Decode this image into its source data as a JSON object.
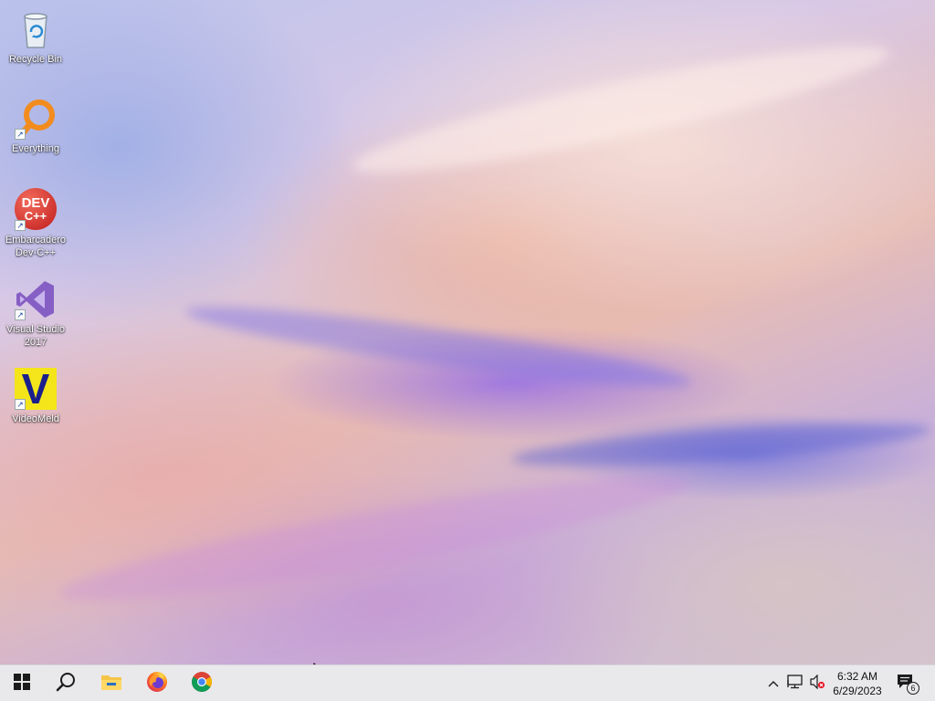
{
  "desktop": {
    "icons": [
      {
        "label": "Recycle Bin",
        "icon": "recycle-bin-icon",
        "shortcut": false
      },
      {
        "label": "Everything",
        "icon": "everything-search-icon",
        "shortcut": true
      },
      {
        "label": "Embarcadero\nDev-C++",
        "icon": "devcpp-icon",
        "icon_text_top": "DEV",
        "icon_text_bottom": "C++",
        "shortcut": true
      },
      {
        "label": "Visual Studio\n2017",
        "icon": "visual-studio-icon",
        "shortcut": true
      },
      {
        "label": "VideoMeld",
        "icon": "videomeld-icon",
        "icon_text": "V",
        "shortcut": true
      }
    ]
  },
  "taskbar": {
    "apps": [
      {
        "name": "Start",
        "icon": "windows-start-icon"
      },
      {
        "name": "Search",
        "icon": "search-icon"
      },
      {
        "name": "File Explorer",
        "icon": "folder-icon"
      },
      {
        "name": "Firefox",
        "icon": "firefox-icon"
      },
      {
        "name": "Chrome",
        "icon": "chrome-icon"
      }
    ],
    "tray": {
      "icons": [
        "chevron-up-icon",
        "network-icon",
        "volume-muted-icon"
      ],
      "time": "6:32 AM",
      "date": "6/29/2023",
      "notification_icon": "action-center-icon",
      "notification_count": "6"
    }
  },
  "colors": {
    "taskbar_bg": "#e9e9ec",
    "windows_blue": "#0078d7",
    "devcpp_red": "#d9302b",
    "vs_purple": "#865fc5",
    "everything_orange": "#f28c1e"
  }
}
